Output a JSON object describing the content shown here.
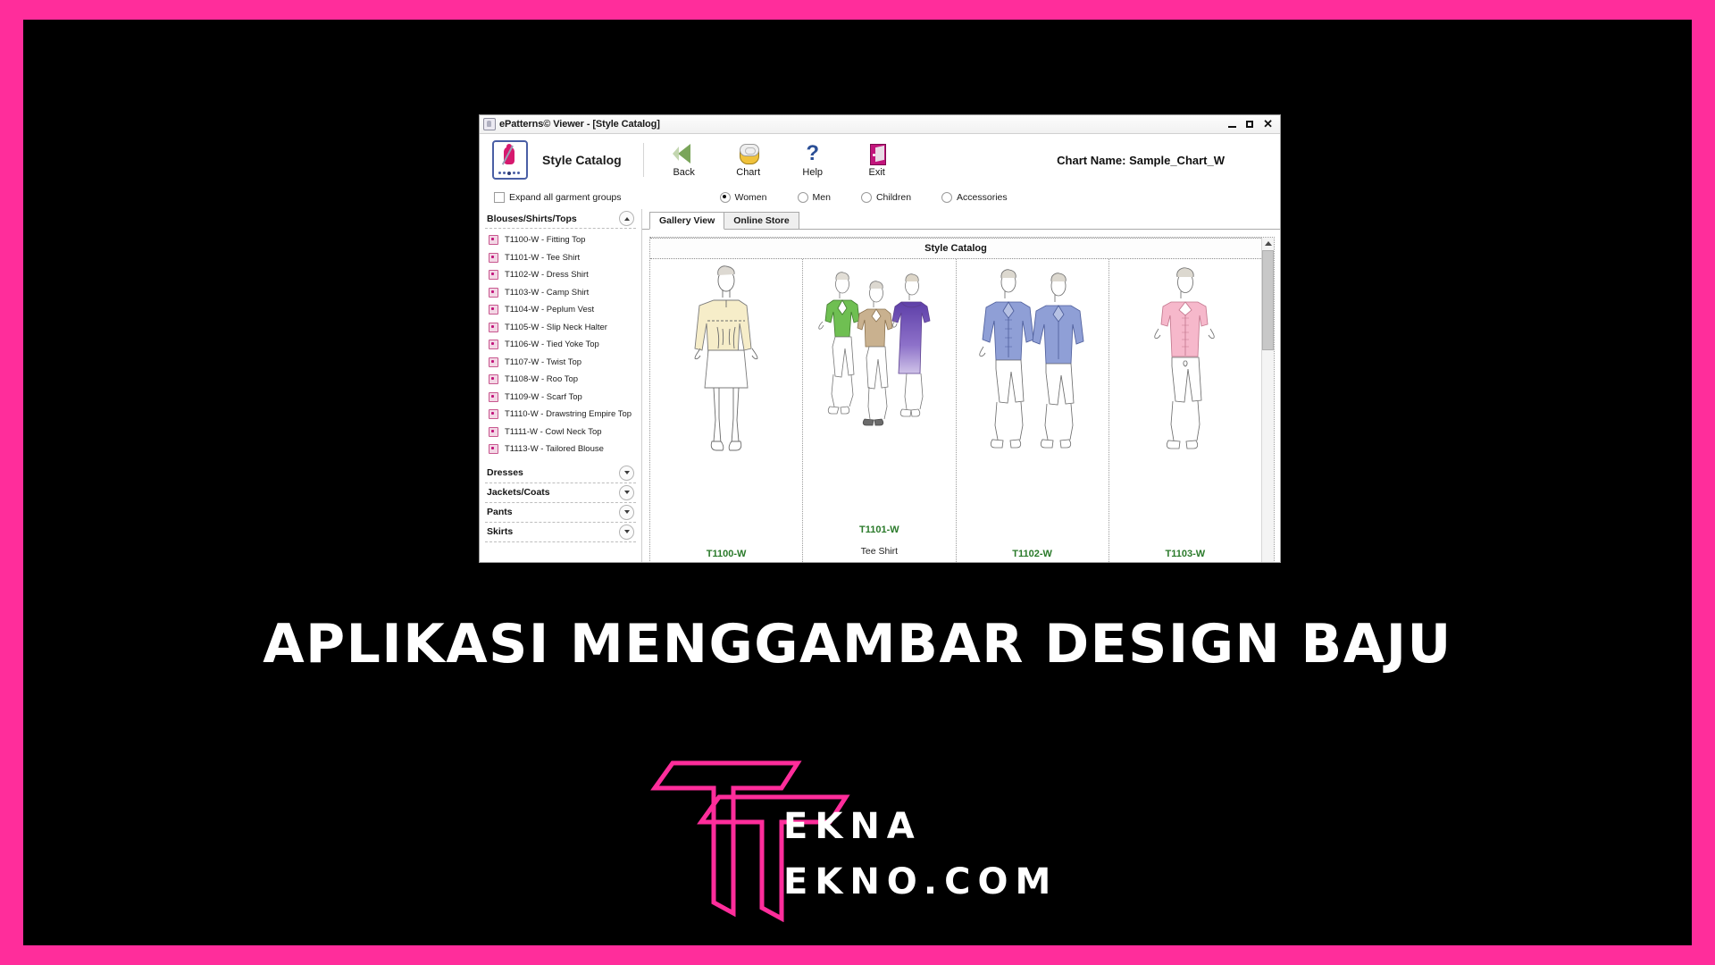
{
  "banner": {
    "headline": "APLIKASI MENGGAMBAR DESIGN BAJU",
    "brand_line1": "EKNA",
    "brand_line2": "EKNO.COM",
    "pink": "#FF2D9B",
    "background": "#000000"
  },
  "window": {
    "title": "ePatterns© Viewer - [Style Catalog]",
    "minimize_label": "",
    "maximize_label": "",
    "close_label": "✕"
  },
  "toolbar": {
    "app_title": "Style Catalog",
    "items": [
      {
        "label": "Back",
        "icon": "back-arrow-icon"
      },
      {
        "label": "Chart",
        "icon": "tape-measure-icon"
      },
      {
        "label": "Help",
        "icon": "question-mark-icon"
      },
      {
        "label": "Exit",
        "icon": "exit-door-icon"
      }
    ],
    "chart_name": "Chart Name: Sample_Chart_W"
  },
  "options": {
    "expand_all_label": "Expand all garment groups",
    "expand_all_checked": false,
    "audience": [
      {
        "label": "Women",
        "selected": true
      },
      {
        "label": "Men",
        "selected": false
      },
      {
        "label": "Children",
        "selected": false
      },
      {
        "label": "Accessories",
        "selected": false
      }
    ]
  },
  "sidebar": {
    "open_group": "Blouses/Shirts/Tops",
    "styles": [
      {
        "code": "T1100-W",
        "name": "Fitting Top",
        "label": "T1100-W - Fitting Top"
      },
      {
        "code": "T1101-W",
        "name": "Tee Shirt",
        "label": "T1101-W - Tee Shirt"
      },
      {
        "code": "T1102-W",
        "name": "Dress Shirt",
        "label": "T1102-W - Dress Shirt"
      },
      {
        "code": "T1103-W",
        "name": "Camp Shirt",
        "label": "T1103-W - Camp Shirt"
      },
      {
        "code": "T1104-W",
        "name": "Peplum Vest",
        "label": "T1104-W - Peplum Vest"
      },
      {
        "code": "T1105-W",
        "name": "Slip Neck Halter",
        "label": "T1105-W - Slip Neck Halter"
      },
      {
        "code": "T1106-W",
        "name": "Tied Yoke Top",
        "label": "T1106-W - Tied Yoke Top"
      },
      {
        "code": "T1107-W",
        "name": "Twist Top",
        "label": "T1107-W - Twist Top"
      },
      {
        "code": "T1108-W",
        "name": "Roo Top",
        "label": "T1108-W - Roo Top"
      },
      {
        "code": "T1109-W",
        "name": "Scarf Top",
        "label": "T1109-W - Scarf Top"
      },
      {
        "code": "T1110-W",
        "name": "Drawstring Empire Top",
        "label": "T1110-W - Drawstring Empire Top"
      },
      {
        "code": "T1111-W",
        "name": "Cowl Neck Top",
        "label": "T1111-W - Cowl Neck Top"
      },
      {
        "code": "T1113-W",
        "name": "Tailored Blouse",
        "label": "T1113-W - Tailored Blouse"
      }
    ],
    "collapsed_groups": [
      "Dresses",
      "Jackets/Coats",
      "Pants",
      "Skirts"
    ]
  },
  "tabs": [
    {
      "label": "Gallery View",
      "active": true
    },
    {
      "label": "Online Store",
      "active": false
    }
  ],
  "gallery": {
    "title": "Style Catalog",
    "cards": [
      {
        "code": "T1100-W",
        "name": "",
        "garment_color": "#f6edc9"
      },
      {
        "code": "T1101-W",
        "name": "Tee Shirt",
        "garment_color": "#6fbf52"
      },
      {
        "code": "T1102-W",
        "name": "",
        "garment_color": "#8f9fd6"
      },
      {
        "code": "T1103-W",
        "name": "",
        "garment_color": "#f6b8cb"
      }
    ]
  }
}
